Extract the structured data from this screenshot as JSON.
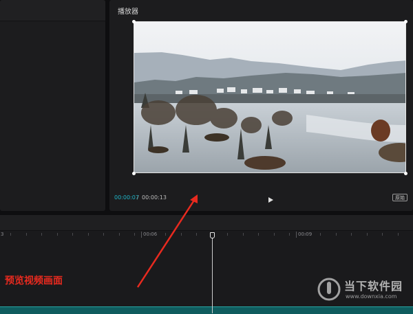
{
  "player": {
    "title": "播放器",
    "current_time": "00:00:07",
    "separator": "/",
    "total_time": "00:00:13",
    "original_label": "原始"
  },
  "timeline": {
    "ruler_labels": [
      "3",
      "00:06",
      "00:09"
    ]
  },
  "annotation": {
    "text": "预览视频画面"
  },
  "watermark": {
    "brand": "当下软件园",
    "url": "www.downxia.com"
  },
  "colors": {
    "accent_time": "#1fb6c9",
    "annotation_red": "#e82a1f",
    "track_teal": "#0f5c5e"
  }
}
